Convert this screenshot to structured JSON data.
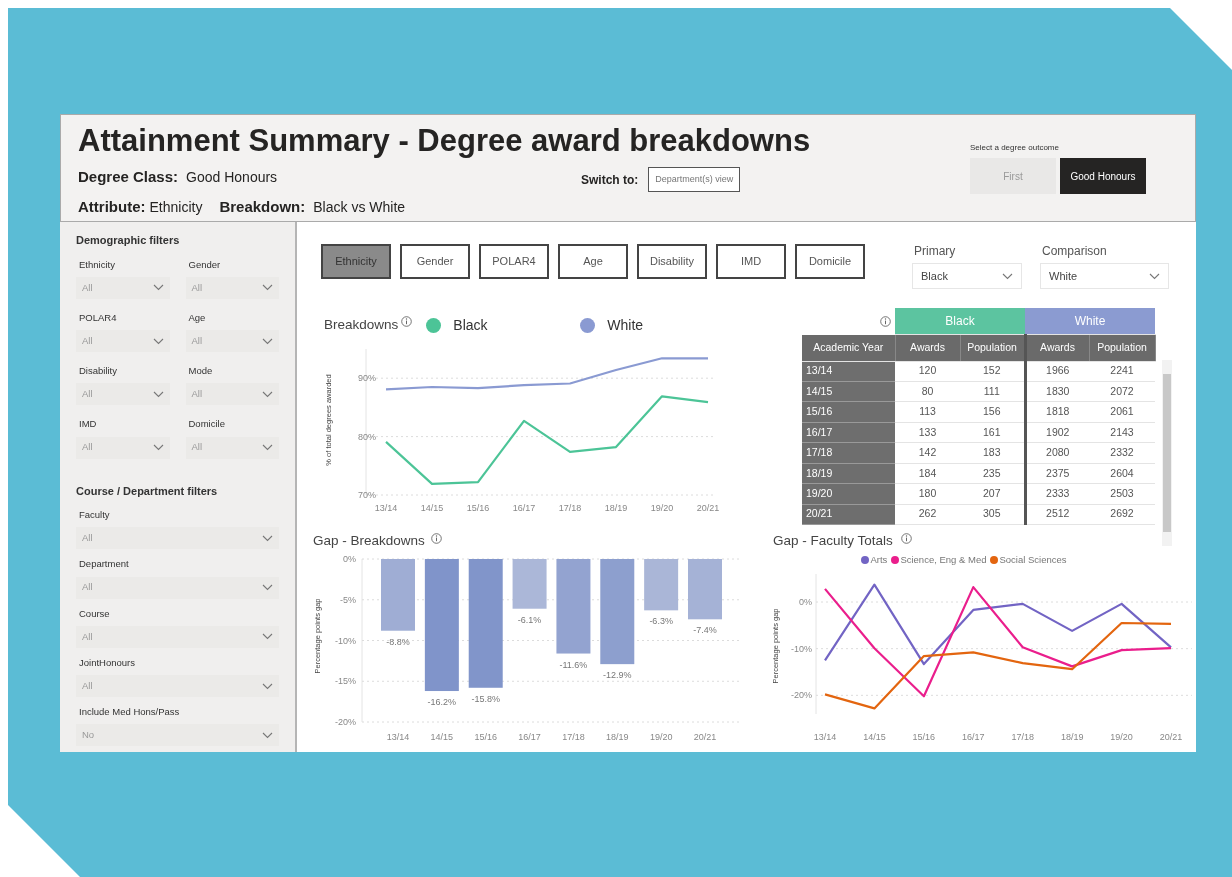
{
  "header": {
    "title": "Attainment Summary - Degree award breakdowns",
    "degree_class": {
      "label": "Degree Class:",
      "value": "Good Honours"
    },
    "attribute": {
      "label": "Attribute:",
      "value": "Ethnicity"
    },
    "breakdown": {
      "label": "Breakdown:",
      "value": "Black vs White"
    },
    "switch_to": {
      "label": "Switch to:",
      "button": "Department(s) view"
    },
    "degree_outcome": {
      "label": "Select a degree outcome",
      "options": [
        {
          "label": "First",
          "selected": false
        },
        {
          "label": "Good Honours",
          "selected": true
        }
      ]
    }
  },
  "sidebar": {
    "sections": [
      {
        "title": "Demographic filters",
        "kind": "grid",
        "filters": [
          {
            "label": "Ethnicity",
            "value": "All"
          },
          {
            "label": "Gender",
            "value": "All"
          },
          {
            "label": "POLAR4",
            "value": "All"
          },
          {
            "label": "Age",
            "value": "All"
          },
          {
            "label": "Disability",
            "value": "All"
          },
          {
            "label": "Mode",
            "value": "All"
          },
          {
            "label": "IMD",
            "value": "All"
          },
          {
            "label": "Domicile",
            "value": "All"
          }
        ]
      },
      {
        "title": "Course / Department filters",
        "kind": "stack",
        "filters": [
          {
            "label": "Faculty",
            "value": "All"
          },
          {
            "label": "Department",
            "value": "All"
          },
          {
            "label": "Course",
            "value": "All"
          },
          {
            "label": "JointHonours",
            "value": "All"
          },
          {
            "label": "Include Med Hons/Pass",
            "value": "No"
          }
        ]
      }
    ]
  },
  "attribute_buttons": [
    {
      "label": "Ethnicity",
      "selected": true
    },
    {
      "label": "Gender",
      "selected": false
    },
    {
      "label": "POLAR4",
      "selected": false
    },
    {
      "label": "Age",
      "selected": false
    },
    {
      "label": "Disability",
      "selected": false
    },
    {
      "label": "IMD",
      "selected": false
    },
    {
      "label": "Domicile",
      "selected": false
    }
  ],
  "selectors": [
    {
      "label": "Primary",
      "value": "Black"
    },
    {
      "label": "Comparison",
      "value": "White"
    }
  ],
  "breakdowns_chart": {
    "title": "Breakdowns",
    "chart_data": {
      "type": "line",
      "ylabel": "% of total degrees awarded",
      "categories": [
        "13/14",
        "14/15",
        "15/16",
        "16/17",
        "17/18",
        "18/19",
        "19/20",
        "20/21"
      ],
      "legend": "top",
      "grid": true,
      "ylim": [
        70,
        95
      ],
      "yticks": [
        {
          "value": 70,
          "label": "70%"
        },
        {
          "value": 80,
          "label": "80%"
        },
        {
          "value": 90,
          "label": "90%"
        }
      ],
      "series": [
        {
          "name": "Black",
          "color": "#4cc497",
          "values": [
            79.1,
            71.9,
            72.2,
            82.7,
            77.4,
            78.2,
            86.9,
            85.9
          ]
        },
        {
          "name": "White",
          "color": "#8a9ad2",
          "values": [
            88.1,
            88.5,
            88.3,
            88.8,
            89.1,
            91.4,
            93.4,
            93.4
          ]
        }
      ]
    }
  },
  "table": {
    "groups": [
      {
        "name": "Black",
        "color": "#5cc4a0"
      },
      {
        "name": "White",
        "color": "#8b9bd1"
      }
    ],
    "columns": [
      "Academic Year",
      "Awards",
      "Population",
      "Awards",
      "Population"
    ],
    "rows": [
      [
        "13/14",
        "120",
        "152",
        "1966",
        "2241"
      ],
      [
        "14/15",
        "80",
        "111",
        "1830",
        "2072"
      ],
      [
        "15/16",
        "113",
        "156",
        "1818",
        "2061"
      ],
      [
        "16/17",
        "133",
        "161",
        "1902",
        "2143"
      ],
      [
        "17/18",
        "142",
        "183",
        "2080",
        "2332"
      ],
      [
        "18/19",
        "184",
        "235",
        "2375",
        "2604"
      ],
      [
        "19/20",
        "180",
        "207",
        "2333",
        "2503"
      ],
      [
        "20/21",
        "262",
        "305",
        "2512",
        "2692"
      ]
    ]
  },
  "gap_breakdowns": {
    "title": "Gap - Breakdowns",
    "chart_data": {
      "type": "bar",
      "ylabel": "Percentage points gap",
      "categories": [
        "13/14",
        "14/15",
        "15/16",
        "16/17",
        "17/18",
        "18/19",
        "19/20",
        "20/21"
      ],
      "values": [
        -8.8,
        -16.2,
        -15.8,
        -6.1,
        -11.6,
        -12.9,
        -6.3,
        -7.4
      ],
      "value_labels": [
        "-8.8%",
        "-16.2%",
        "-15.8%",
        "-6.1%",
        "-11.6%",
        "-12.9%",
        "-6.3%",
        "-7.4%"
      ],
      "ylim": [
        -20,
        0
      ],
      "grid": true,
      "yticks": [
        {
          "value": 0,
          "label": "0%"
        },
        {
          "value": -5,
          "label": "-5%"
        },
        {
          "value": -10,
          "label": "-10%"
        },
        {
          "value": -15,
          "label": "-15%"
        },
        {
          "value": -20,
          "label": "-20%"
        }
      ]
    }
  },
  "gap_faculty": {
    "title": "Gap - Faculty Totals",
    "chart_data": {
      "type": "line",
      "ylabel": "Percentage points gap",
      "categories": [
        "13/14",
        "14/15",
        "15/16",
        "16/17",
        "17/18",
        "18/19",
        "19/20",
        "20/21"
      ],
      "legend": "top",
      "grid": true,
      "ylim": [
        -24,
        6
      ],
      "yticks": [
        {
          "value": 0,
          "label": "0%"
        },
        {
          "value": -10,
          "label": "-10%"
        },
        {
          "value": -20,
          "label": "-20%"
        }
      ],
      "series": [
        {
          "name": "Arts",
          "color": "#7264c4",
          "values": [
            -12.5,
            3.7,
            -13.3,
            -1.7,
            -0.4,
            -6.2,
            -0.4,
            -9.7
          ]
        },
        {
          "name": "Science, Eng & Med",
          "color": "#ea1e8c",
          "values": [
            2.8,
            -9.9,
            -20.2,
            3.2,
            -9.7,
            -13.8,
            -10.3,
            -9.9
          ]
        },
        {
          "name": "Social Sciences",
          "color": "#e3650f",
          "values": [
            -19.8,
            -22.8,
            -11.6,
            -10.8,
            -13.1,
            -14.4,
            -4.5,
            -4.7
          ]
        }
      ]
    }
  }
}
